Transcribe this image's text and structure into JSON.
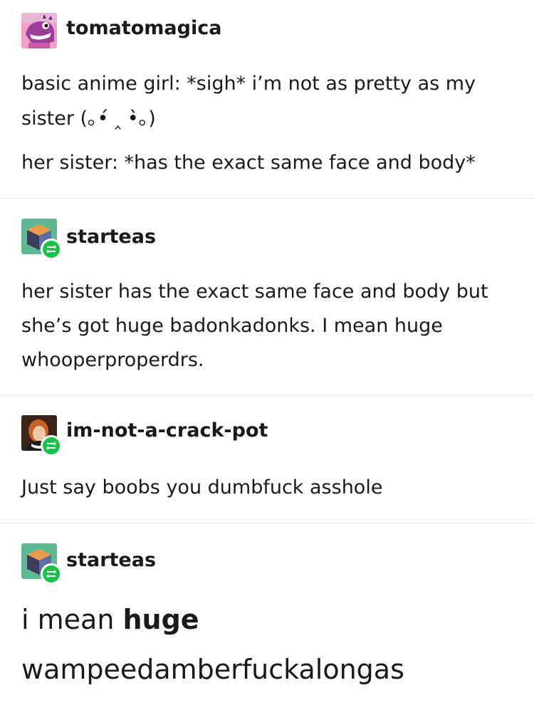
{
  "posts": [
    {
      "username": "tomatomagica",
      "avatar_icon": "pink-monster-avatar-icon",
      "is_reblog": false,
      "lines": [
        "basic anime girl: *sigh* i’m not as pretty as my",
        "sister (｡•́ ‸ •̀｡)",
        "her sister: *has the exact same face and body*"
      ]
    },
    {
      "username": "starteas",
      "avatar_icon": "cube-avatar-icon",
      "is_reblog": true,
      "lines": [
        "her sister has the exact same face and body but",
        "she’s got huge badonkadonks. I mean huge",
        "whooperproperdrs."
      ]
    },
    {
      "username": "im-not-a-crack-pot",
      "avatar_icon": "portrait-avatar-icon",
      "is_reblog": true,
      "lines": [
        "Just say boobs you dumbfuck asshole"
      ]
    },
    {
      "username": "starteas",
      "avatar_icon": "cube-avatar-icon",
      "is_reblog": true,
      "big_line1_prefix": "i mean ",
      "big_line1_bold": "huge",
      "big_line2": "wampeedamberfuckalongas"
    }
  ],
  "colors": {
    "reblog_badge": "#18c14a",
    "divider": "#e4e4e4",
    "text": "#1a1a1a"
  }
}
